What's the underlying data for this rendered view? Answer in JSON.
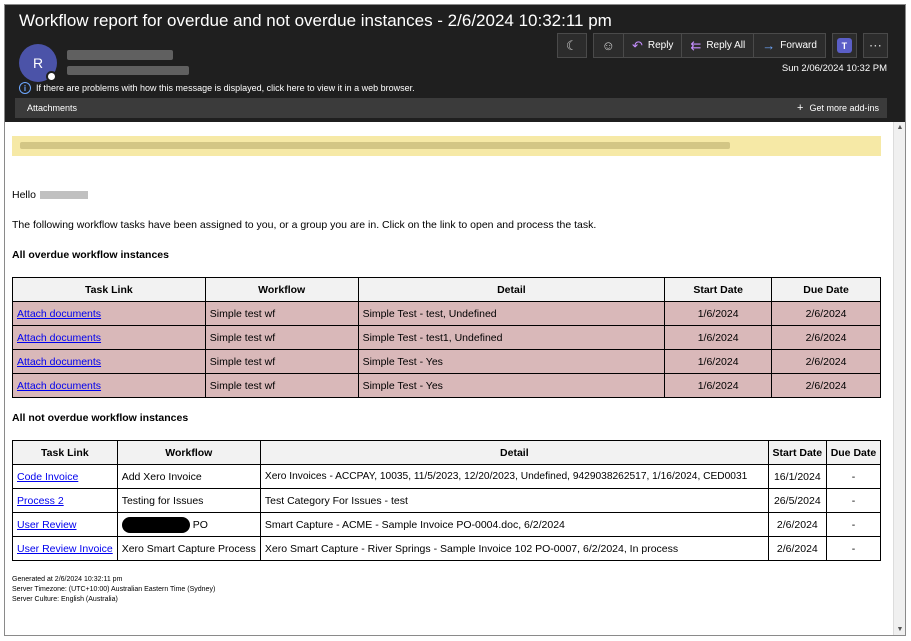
{
  "email": {
    "subject": "Workflow report for overdue and not overdue instances - 2/6/2024 10:32:11 pm",
    "avatar_initial": "R",
    "datetime": "Sun 2/06/2024 10:32 PM",
    "info_text": "If there are problems with how this message is displayed, click here to view it in a web browser.",
    "attachments_label": "Attachments",
    "get_addins_label": "Get more add-ins"
  },
  "toolbar": {
    "reply": "Reply",
    "reply_all": "Reply All",
    "forward": "Forward"
  },
  "body": {
    "greeting": "Hello",
    "intro": "The following workflow tasks have been assigned to you, or a group you are in. Click on the link to open and process the task.",
    "overdue_heading": "All overdue workflow instances",
    "not_overdue_heading": "All not overdue workflow instances"
  },
  "overdue_table": {
    "headers": [
      "Task Link",
      "Workflow",
      "Detail",
      "Start Date",
      "Due Date"
    ],
    "rows": [
      {
        "link": "Attach documents",
        "workflow": "Simple test wf",
        "detail": "Simple Test - test, Undefined",
        "start": "1/6/2024",
        "due": "2/6/2024"
      },
      {
        "link": "Attach documents",
        "workflow": "Simple test wf",
        "detail": "Simple Test - test1, Undefined",
        "start": "1/6/2024",
        "due": "2/6/2024"
      },
      {
        "link": "Attach documents",
        "workflow": "Simple test wf",
        "detail": "Simple Test - Yes",
        "start": "1/6/2024",
        "due": "2/6/2024"
      },
      {
        "link": "Attach documents",
        "workflow": "Simple test wf",
        "detail": "Simple Test - Yes",
        "start": "1/6/2024",
        "due": "2/6/2024"
      }
    ]
  },
  "not_overdue_table": {
    "headers": [
      "Task Link",
      "Workflow",
      "Detail",
      "Start Date",
      "Due Date"
    ],
    "rows": [
      {
        "link": "Code Invoice",
        "workflow": "Add Xero Invoice",
        "detail": "Xero Invoices - ACCPAY, 10035, 11/5/2023, 12/20/2023, Undefined, 9429038262517, 1/16/2024, CED0031",
        "start": "16/1/2024",
        "due": "-"
      },
      {
        "link": "Process 2",
        "workflow": "Testing for Issues",
        "detail": "Test Category For Issues - test",
        "start": "26/5/2024",
        "due": "-"
      },
      {
        "link": "User Review",
        "workflow": "PO",
        "detail": "Smart Capture - ACME - Sample Invoice PO-0004.doc, 6/2/2024",
        "start": "2/6/2024",
        "due": "-"
      },
      {
        "link": "User Review Invoice",
        "workflow": "Xero Smart Capture Process",
        "detail": "Xero Smart Capture - River Springs - Sample Invoice 102 PO-0007, 6/2/2024, In process",
        "start": "2/6/2024",
        "due": "-"
      }
    ]
  },
  "footer": {
    "generated": "Generated at 2/6/2024 10:32:11 pm",
    "timezone": "Server Timezone: (UTC+10:00) Australian Eastern Time (Sydney)",
    "culture": "Server Culture: English (Australia)"
  }
}
